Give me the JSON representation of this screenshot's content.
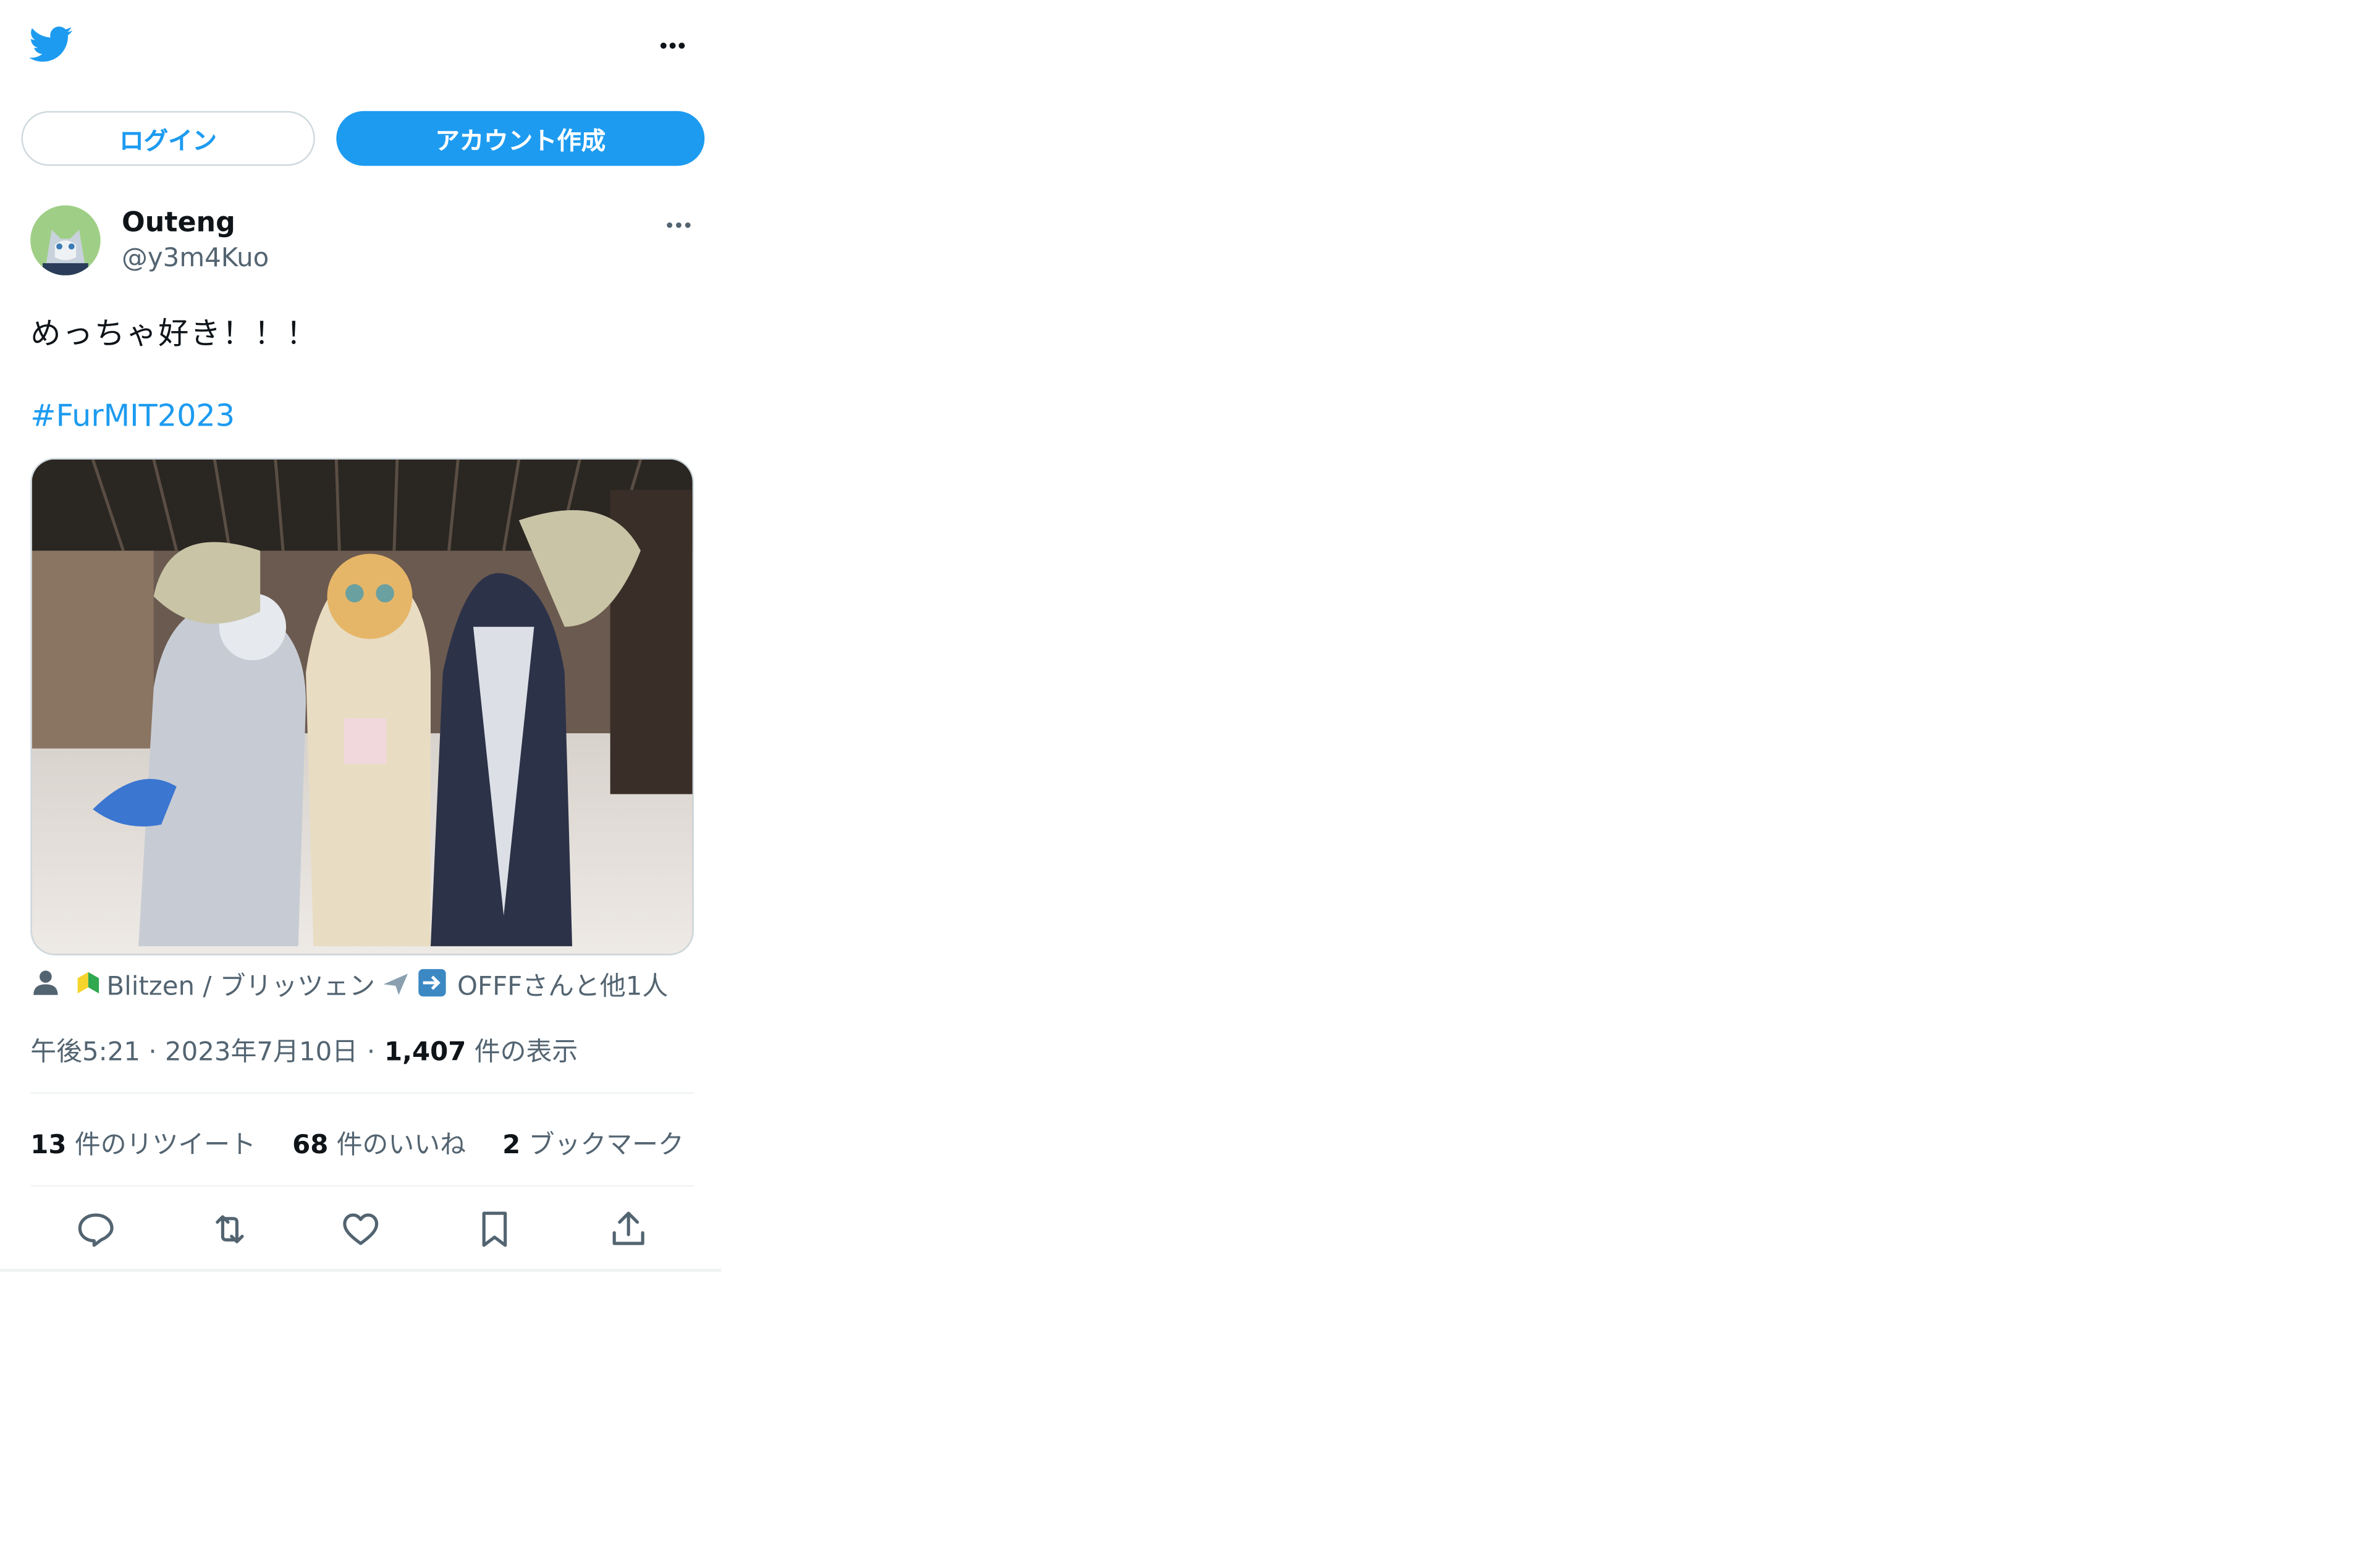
{
  "header": {
    "logo_icon": "twitter-bird-icon",
    "more_icon": "more-horizontal-icon",
    "login_label": "ログイン",
    "signup_label": "アカウント作成",
    "brand_color": "#1d9bf0"
  },
  "tweet": {
    "author": {
      "display_name": "Outeng",
      "handle": "@y3m4Kuo",
      "avatar_icon": "avatar-image"
    },
    "text": "めっちゃ好き！！！",
    "hashtag": "#FurMIT2023",
    "photo_icon": "photo-image",
    "tagged": {
      "icon": "person-icon",
      "text_pre": "Blitzen / ブリッツェン",
      "text_post": "OFFFさんと他1人"
    },
    "meta": {
      "time": "午後5:21",
      "date": "2023年7月10日",
      "separator": "·",
      "views_count": "1,407",
      "views_label": "件の表示"
    },
    "stats": {
      "retweets_count": "13",
      "retweets_label": "件のリツイート",
      "likes_count": "68",
      "likes_label": "件のいいね",
      "bookmarks_count": "2",
      "bookmarks_label": "ブックマーク"
    },
    "actions": [
      "reply-icon",
      "retweet-icon",
      "like-icon",
      "bookmark-icon",
      "share-icon"
    ]
  }
}
